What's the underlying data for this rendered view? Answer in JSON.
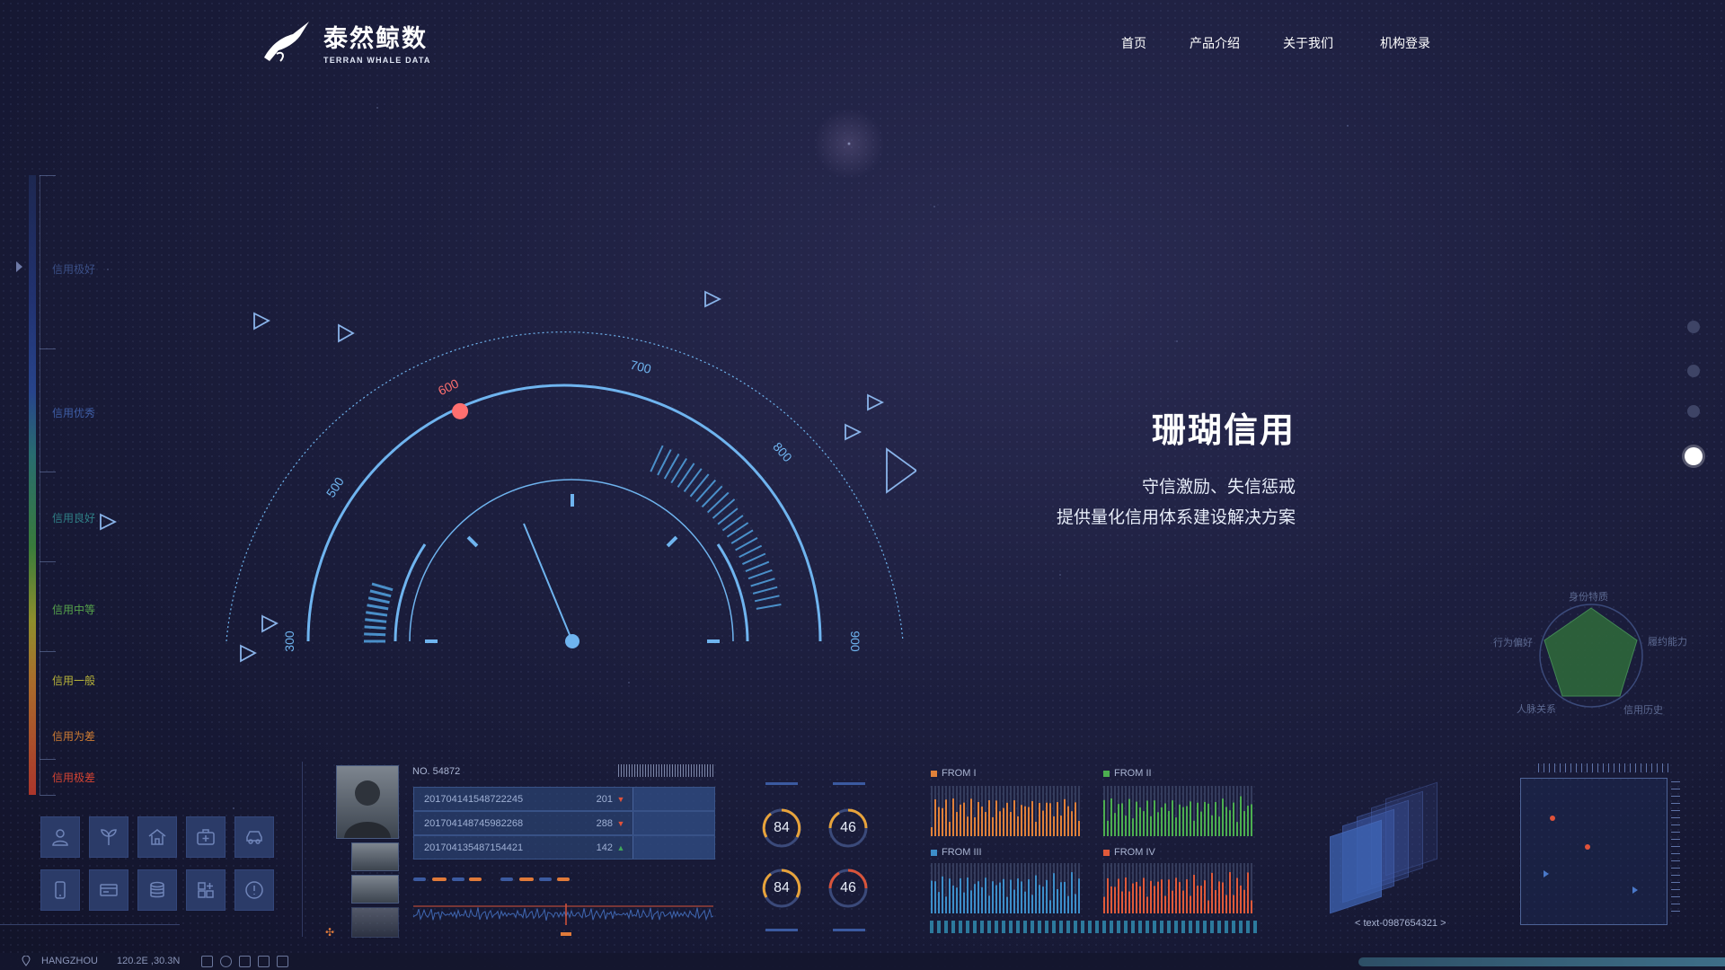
{
  "header": {
    "logo_cn": "泰然鲸数",
    "logo_en": "TERRAN WHALE DATA",
    "nav": [
      "首页",
      "产品介绍",
      "关于我们",
      "机构登录"
    ]
  },
  "credit_scale": {
    "labels": [
      {
        "text": "信用极好",
        "color": "#3b4f86"
      },
      {
        "text": "信用优秀",
        "color": "#3f5ea6"
      },
      {
        "text": "信用良好",
        "color": "#2f7f86"
      },
      {
        "text": "信用中等",
        "color": "#55a24b"
      },
      {
        "text": "信用一般",
        "color": "#b8b43a"
      },
      {
        "text": "信用为差",
        "color": "#cf7c33"
      },
      {
        "text": "信用极差",
        "color": "#d44433"
      }
    ]
  },
  "gauge": {
    "ticks": [
      "300",
      "500",
      "600",
      "700",
      "800",
      "900"
    ],
    "value": 600,
    "accent": "#ff6f6f",
    "arc_color": "#6fb4ef"
  },
  "hero": {
    "title": "珊瑚信用",
    "line1": "守信激励、失信惩戒",
    "line2": "提供量化信用体系建设解决方案"
  },
  "side_nav": {
    "count": 4,
    "active": 4
  },
  "radar": {
    "labels": [
      "身份特质",
      "履约能力",
      "信用历史",
      "人脉关系",
      "行为偏好"
    ]
  },
  "record": {
    "no": "NO. 54872",
    "rows": [
      {
        "id": "201704141548722245",
        "value": "201",
        "trend": "down"
      },
      {
        "id": "201704148745982268",
        "value": "288",
        "trend": "down"
      },
      {
        "id": "201704135487154421",
        "value": "142",
        "trend": "up"
      }
    ]
  },
  "rings": [
    {
      "value": "84",
      "color": "#e8a33a"
    },
    {
      "value": "46",
      "color": "#e8a33a"
    },
    {
      "value": "84",
      "color": "#e8a33a"
    },
    {
      "value": "46",
      "color": "#d9543a"
    }
  ],
  "mini_charts": [
    {
      "label": "FROM I",
      "color": "#e0813a"
    },
    {
      "label": "FROM II",
      "color": "#4caf50"
    },
    {
      "label": "FROM III",
      "color": "#3d8ec9"
    },
    {
      "label": "FROM IV",
      "color": "#e05a3a"
    }
  ],
  "text_tag": "< text-0987654321 >",
  "status": {
    "city": "HANGZHOU",
    "coord": "120.2E ,30.3N"
  }
}
